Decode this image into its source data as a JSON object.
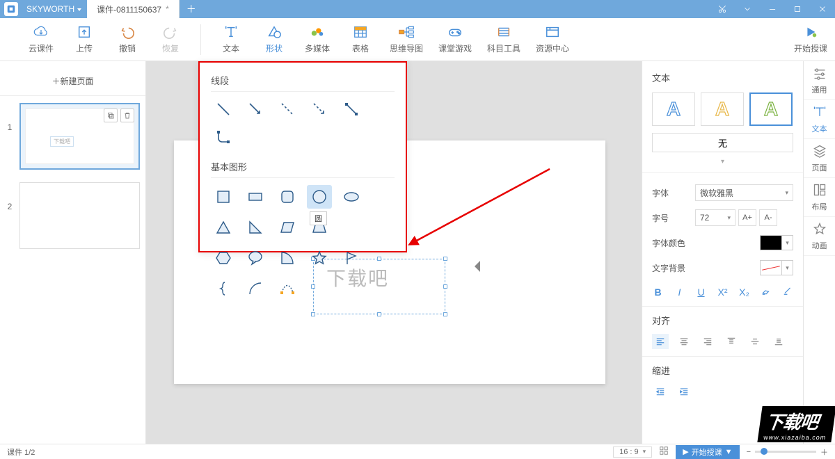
{
  "app": {
    "name": "SKYWORTH",
    "doc": "课件-0811150637",
    "dirty": "*"
  },
  "toolbar": {
    "cloud": "云课件",
    "upload": "上传",
    "undo": "撤销",
    "redo": "恢复",
    "text": "文本",
    "shape": "形状",
    "media": "多媒体",
    "table": "表格",
    "mindmap": "思维导图",
    "game": "课堂游戏",
    "subject": "科目工具",
    "resource": "资源中心",
    "start": "开始授课"
  },
  "slides": {
    "new_page": "＋新建页面",
    "count": 2,
    "items": [
      "1",
      "2"
    ],
    "thumb_text": "下载吧"
  },
  "canvas": {
    "text": "下载吧"
  },
  "popup": {
    "section_lines": "线段",
    "section_shapes": "基本图形",
    "tooltip": "圆"
  },
  "format": {
    "title": "文本",
    "none_btn": "无",
    "font_label": "字体",
    "font_value": "微软雅黑",
    "size_label": "字号",
    "size_value": "72",
    "inc": "A+",
    "dec": "A-",
    "color_label": "字体颜色",
    "color_value": "#000000",
    "bg_label": "文字背景",
    "align_label": "对齐",
    "indent_label": "缩进"
  },
  "rail": {
    "general": "通用",
    "text": "文本",
    "page": "页面",
    "layout": "布局",
    "anim": "动画"
  },
  "status": {
    "page": "课件 1/2",
    "ratio": "16 : 9",
    "start": "开始授课"
  },
  "watermark": {
    "big": "下载吧",
    "url": "www.xiazaiba.com"
  }
}
